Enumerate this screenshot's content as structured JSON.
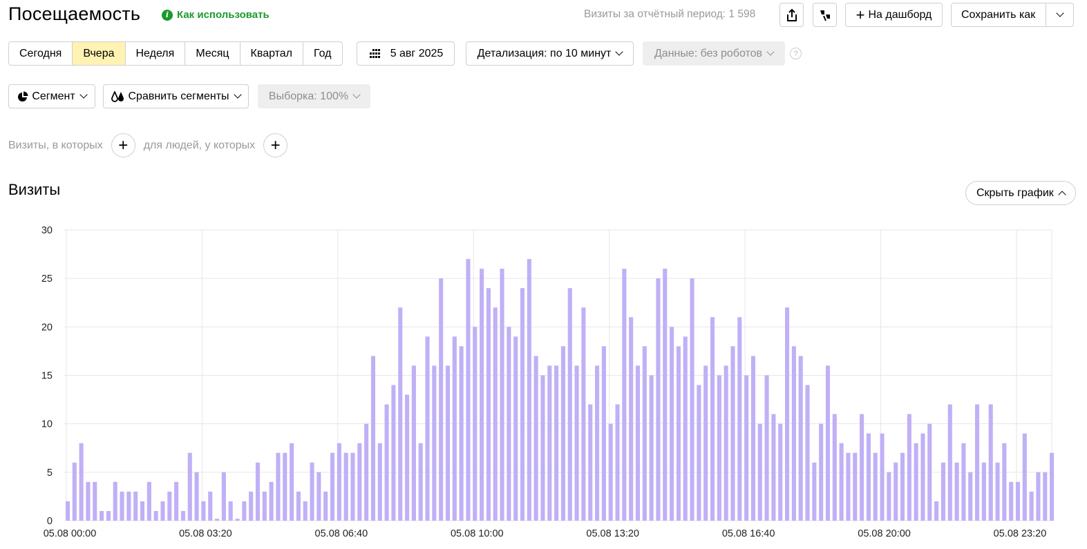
{
  "header": {
    "title": "Посещаемость",
    "howto": "Как использовать",
    "visits_total": "Визиты за отчётный период: 1 598",
    "to_dashboard": "На дашборд",
    "save_as": "Сохранить как"
  },
  "periods": [
    "Сегодня",
    "Вчера",
    "Неделя",
    "Месяц",
    "Квартал",
    "Год"
  ],
  "active_period": "Вчера",
  "date": "5 авг 2025",
  "detail": "Детализация: по 10 минут",
  "data_filter": "Данные: без роботов",
  "segment": "Сегмент",
  "compare": "Сравнить сегменты",
  "sample": "Выборка: 100%",
  "filters": {
    "visits_where": "Визиты, в которых",
    "people_where": "для людей, у которых"
  },
  "section_title": "Визиты",
  "hide_chart": "Скрыть график",
  "colors": {
    "bar": "#c0b0f6",
    "accent_green": "#1a9a2e",
    "active_period_bg": "#fff2b3"
  },
  "chart_data": {
    "type": "bar",
    "ylim": [
      0,
      30
    ],
    "y_ticks": [
      0,
      5,
      10,
      15,
      20,
      25,
      30
    ],
    "x_tick_labels": [
      "05.08 00:00",
      "05.08 03:20",
      "05.08 06:40",
      "05.08 10:00",
      "05.08 13:20",
      "05.08 16:40",
      "05.08 20:00",
      "05.08 23:20"
    ],
    "x_tick_every": 20,
    "grid": true,
    "values": [
      2,
      6,
      8,
      4,
      4,
      1,
      1,
      4,
      3,
      3,
      3,
      2,
      4,
      1,
      2,
      3,
      4,
      1,
      7,
      5,
      2,
      3,
      0.2,
      5,
      2,
      0.2,
      2,
      3,
      6,
      3,
      4,
      7,
      7,
      8,
      3,
      2,
      6,
      5,
      3,
      7,
      8,
      7,
      7,
      8,
      10,
      17,
      8,
      12,
      14,
      22,
      13,
      16,
      8,
      19,
      16,
      25,
      16,
      19,
      18,
      27,
      20,
      26,
      24,
      22,
      26,
      20,
      19,
      24,
      27,
      17,
      15,
      16,
      16,
      18,
      24,
      16,
      22,
      12,
      16,
      18,
      10,
      12,
      26,
      21,
      16,
      18,
      15,
      25,
      26,
      20,
      18,
      19,
      25,
      14,
      16,
      21,
      15,
      16,
      18,
      21,
      15,
      17,
      10,
      15,
      11,
      10,
      22,
      18,
      17,
      14,
      6,
      10,
      16,
      11,
      8,
      7,
      7,
      11,
      9,
      7,
      9,
      5,
      6,
      7,
      11,
      8,
      9,
      10,
      2,
      6,
      12,
      6,
      8,
      5,
      12,
      6,
      12,
      6,
      8,
      4,
      4,
      9,
      3,
      5,
      5,
      7
    ]
  }
}
